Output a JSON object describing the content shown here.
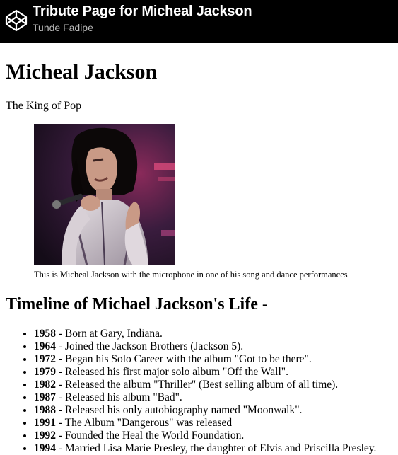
{
  "header": {
    "title": "Tribute Page for Micheal Jackson",
    "author": "Tunde Fadipe",
    "logo_icon": "codepen-logo-icon"
  },
  "main": {
    "heading": "Micheal Jackson",
    "tagline": "The King of Pop",
    "image_caption": "This is Micheal Jackson with the microphone in one of his song and dance performances",
    "timeline_heading": "Timeline of Michael Jackson's Life -",
    "timeline": [
      {
        "year": "1958",
        "text": " - Born at Gary, Indiana."
      },
      {
        "year": "1964",
        "text": " - Joined the Jackson Brothers (Jackson 5)."
      },
      {
        "year": "1972",
        "text": " - Began his Solo Career with the album \"Got to be there\"."
      },
      {
        "year": "1979",
        "text": " - Released his first major solo album \"Off the Wall\"."
      },
      {
        "year": "1982",
        "text": " - Released the album \"Thriller\" (Best selling album of all time)."
      },
      {
        "year": "1987",
        "text": " - Released his album \"Bad\"."
      },
      {
        "year": "1988",
        "text": " - Released his only autobiography named \"Moonwalk\"."
      },
      {
        "year": "1991",
        "text": " - The Album \"Dangerous\" was released"
      },
      {
        "year": "1992",
        "text": " - Founded the Heal the World Foundation."
      },
      {
        "year": "1994",
        "text": " - Married Lisa Marie Presley, the daughter of Elvis and Priscilla Presley."
      }
    ]
  },
  "colors": {
    "header_bg": "#000000",
    "header_text": "#ffffff",
    "author_text": "#b9b9b9"
  }
}
